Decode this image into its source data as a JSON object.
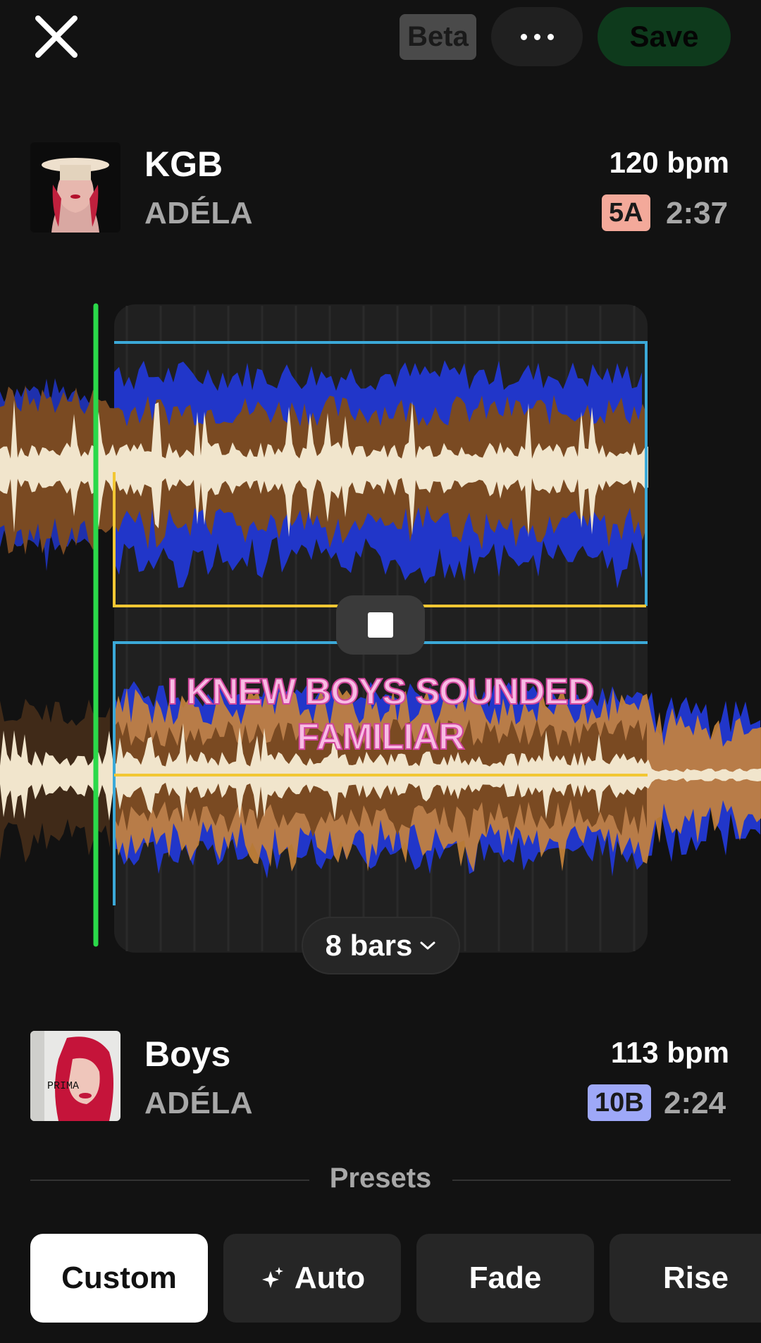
{
  "topbar": {
    "beta_label": "Beta",
    "save_label": "Save"
  },
  "track_a": {
    "title": "KGB",
    "artist": "ADÉLA",
    "bpm": "120 bpm",
    "key": "5A",
    "key_color": "#f3a99a",
    "duration": "2:37"
  },
  "track_b": {
    "title": "Boys",
    "artist": "ADÉLA",
    "bpm": "113 bpm",
    "key": "10B",
    "key_color": "#9ea8f8",
    "duration": "2:24",
    "cover_text": "PRIMA"
  },
  "lyric": "I KNEW BOYS SOUNDED FAMILIAR",
  "bars_selector": "8 bars",
  "presets": {
    "label": "Presets",
    "items": [
      "Custom",
      "Auto",
      "Fade",
      "Rise"
    ],
    "selected": "Custom"
  },
  "colors": {
    "playhead": "#2bd94a",
    "marker_blue": "#3ba9d8",
    "marker_yellow": "#f2c733",
    "wave_blue": "#2136c9",
    "wave_brown": "#7a4a22",
    "wave_cream": "#f1e5cc",
    "wave_orange": "#c9843a"
  }
}
